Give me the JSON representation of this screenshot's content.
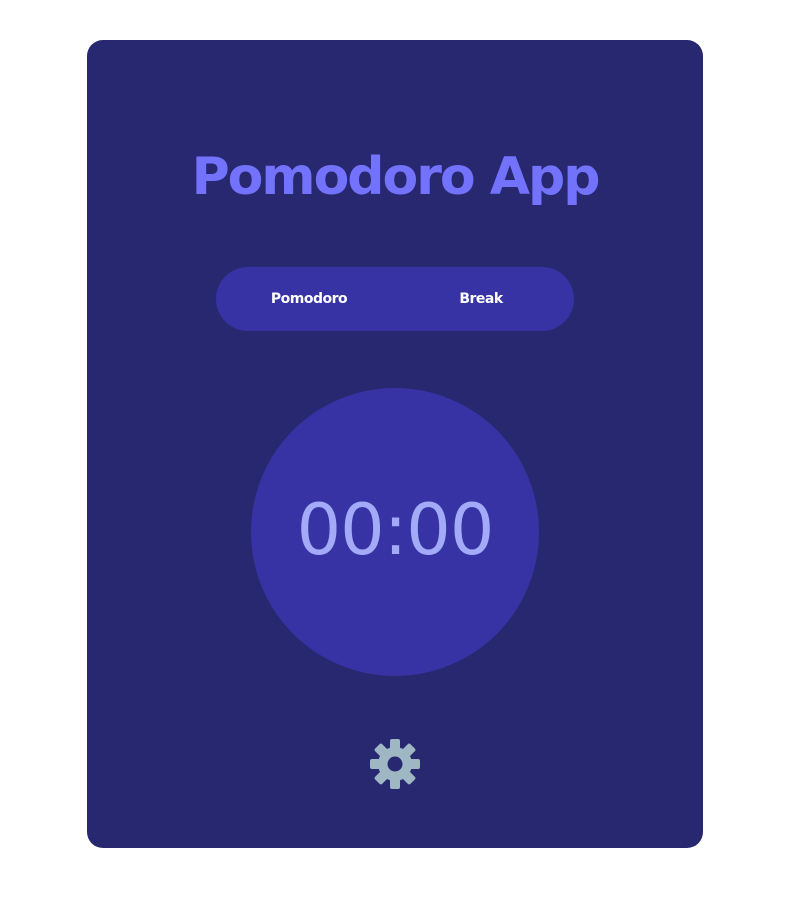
{
  "app": {
    "title": "Pomodoro App"
  },
  "modes": {
    "pomodoro_label": "Pomodoro",
    "break_label": "Break"
  },
  "timer": {
    "display": "00:00"
  },
  "settings": {
    "icon": "gear-icon"
  },
  "colors": {
    "card_background": "#282870",
    "panel_background": "#3733a4",
    "title_accent": "#7272fc",
    "timer_text": "#a3aaf8",
    "gear_icon": "#9fb6c3",
    "page_background": "#ffffff"
  }
}
